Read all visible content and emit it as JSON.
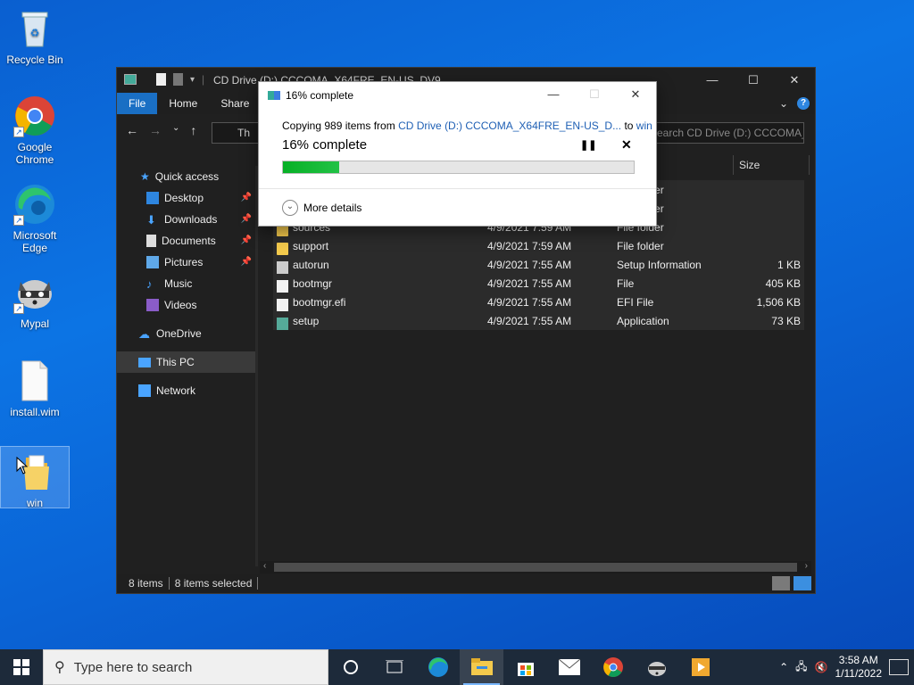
{
  "desktop": {
    "icons": [
      {
        "label": "Recycle Bin",
        "icon": "recycle-bin-icon"
      },
      {
        "label": "Google Chrome",
        "icon": "chrome-icon"
      },
      {
        "label": "Microsoft Edge",
        "icon": "edge-icon"
      },
      {
        "label": "Mypal",
        "icon": "mypal-raccoon-icon"
      },
      {
        "label": "install.wim",
        "icon": "file-icon"
      },
      {
        "label": "win",
        "icon": "folder-icon"
      }
    ]
  },
  "explorer": {
    "title": "CD Drive (D:) CCCOMA_X64FRE_EN-US_DV9",
    "ribbon_tabs": [
      "File",
      "Home",
      "Share"
    ],
    "address_partial": "Th",
    "search_placeholder": "Search CD Drive (D:) CCCOMA_X64...",
    "column_size": "Size",
    "sidebar": {
      "quick_access": "Quick access",
      "items": [
        "Desktop",
        "Downloads",
        "Documents",
        "Pictures",
        "Music",
        "Videos"
      ],
      "onedrive": "OneDrive",
      "this_pc": "This PC",
      "network": "Network"
    },
    "files": [
      {
        "name": "",
        "date": "",
        "type": "File folder",
        "size": ""
      },
      {
        "name": "",
        "date": "",
        "type": "File folder",
        "size": ""
      },
      {
        "name": "sources",
        "date": "4/9/2021 7:59 AM",
        "type": "File folder",
        "size": ""
      },
      {
        "name": "support",
        "date": "4/9/2021 7:59 AM",
        "type": "File folder",
        "size": ""
      },
      {
        "name": "autorun",
        "date": "4/9/2021 7:55 AM",
        "type": "Setup Information",
        "size": "1 KB"
      },
      {
        "name": "bootmgr",
        "date": "4/9/2021 7:55 AM",
        "type": "File",
        "size": "405 KB"
      },
      {
        "name": "bootmgr.efi",
        "date": "4/9/2021 7:55 AM",
        "type": "EFI File",
        "size": "1,506 KB"
      },
      {
        "name": "setup",
        "date": "4/9/2021 7:55 AM",
        "type": "Application",
        "size": "73 KB"
      }
    ],
    "status": {
      "items": "8 items",
      "selected": "8 items selected"
    }
  },
  "dialog": {
    "title": "16% complete",
    "copy_prefix": "Copying 989 items from ",
    "source": "CD Drive (D:) CCCOMA_X64FRE_EN-US_D...",
    "to_word": " to ",
    "dest": "win",
    "percent_text": "16% complete",
    "progress": 0.16,
    "more_details": "More details"
  },
  "taskbar": {
    "search_placeholder": "Type here to search",
    "time": "3:58 AM",
    "date": "1/11/2022"
  },
  "colors": {
    "accent": "#1a6fc4",
    "progress": "#06b025"
  }
}
